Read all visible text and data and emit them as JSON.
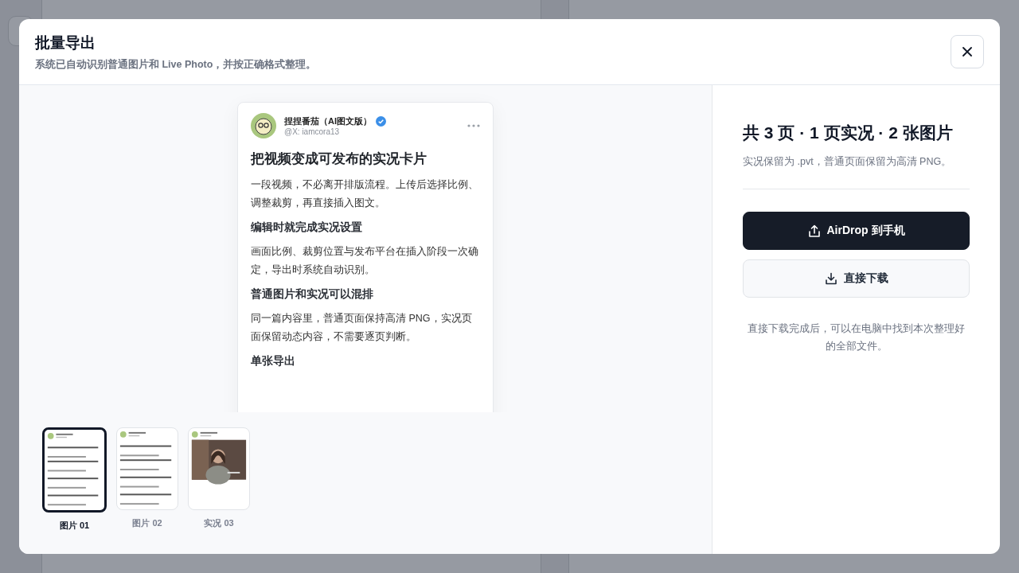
{
  "dialog": {
    "title": "批量导出",
    "subtitle": "系统已自动识别普通图片和 Live Photo，并按正确格式整理。"
  },
  "preview": {
    "author": "捏捏番茄（AI图文版）",
    "verified": true,
    "handle": "@X: iamcora13",
    "blocks": [
      {
        "kind": "title",
        "text": "把视频变成可发布的实况卡片"
      },
      {
        "kind": "paragraph",
        "text": "一段视频，不必离开排版流程。上传后选择比例、调整裁剪，再直接插入图文。"
      },
      {
        "kind": "heading",
        "text": "编辑时就完成实况设置"
      },
      {
        "kind": "paragraph",
        "text": "画面比例、裁剪位置与发布平台在插入阶段一次确定，导出时系统自动识别。"
      },
      {
        "kind": "heading",
        "text": "普通图片和实况可以混排"
      },
      {
        "kind": "paragraph",
        "text": "同一篇内容里，普通页面保持高清 PNG，实况页面保留动态内容，不需要逐页判断。"
      },
      {
        "kind": "heading",
        "text": "单张导出"
      }
    ]
  },
  "thumbnails": [
    {
      "label": "图片 01",
      "selected": true,
      "kind": "text"
    },
    {
      "label": "图片 02",
      "selected": false,
      "kind": "text"
    },
    {
      "label": "实况 03",
      "selected": false,
      "kind": "live"
    }
  ],
  "summary": {
    "title": "共 3 页 · 1 页实况 · 2 张图片",
    "note": "实况保留为 .pvt，普通页面保留为高清 PNG。"
  },
  "buttons": [
    {
      "label": "AirDrop 到手机",
      "kind": "primary"
    },
    {
      "label": "直接下载",
      "kind": "secondary"
    }
  ],
  "footnote": "直接下载完成后，可以在电脑中找到本次整理好的全部文件。"
}
